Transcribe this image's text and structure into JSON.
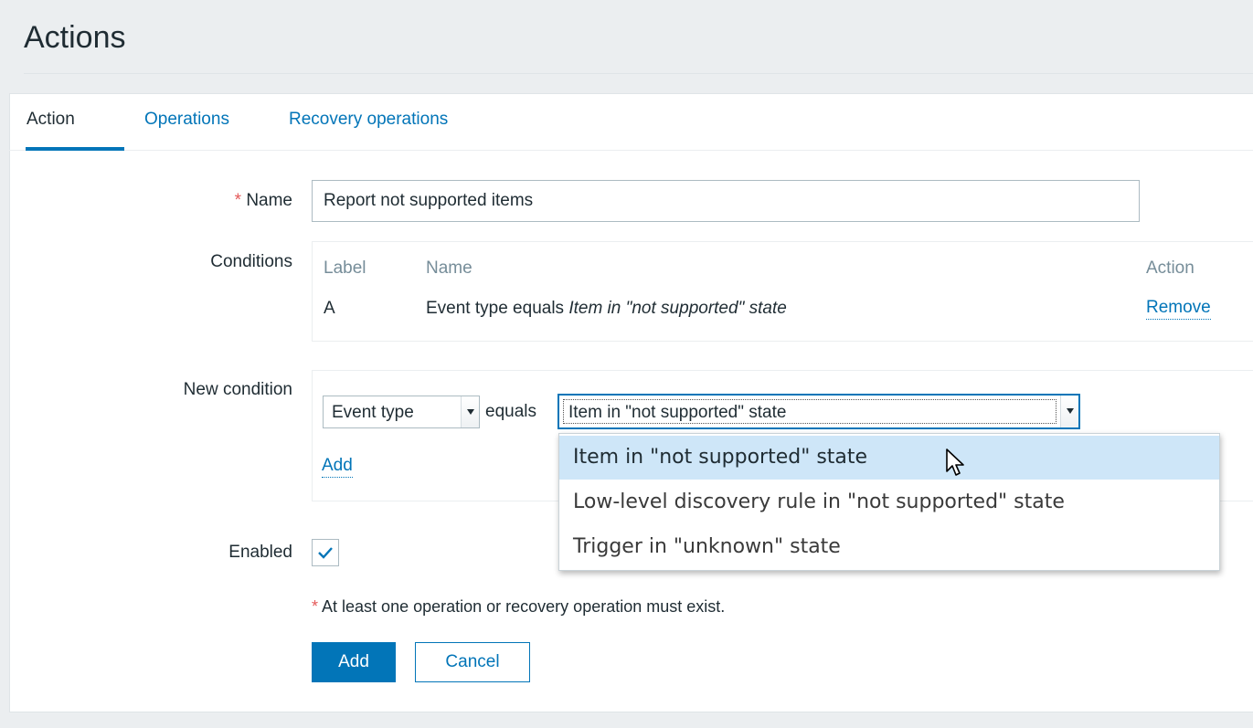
{
  "page": {
    "title": "Actions"
  },
  "tabs": [
    {
      "label": "Action",
      "active": true
    },
    {
      "label": "Operations",
      "active": false
    },
    {
      "label": "Recovery operations",
      "active": false
    }
  ],
  "form": {
    "name": {
      "label": "Name",
      "required_mark": "*",
      "value": "Report not supported items"
    },
    "conditions": {
      "label": "Conditions",
      "columns": {
        "label": "Label",
        "name": "Name",
        "action": "Action"
      },
      "rows": [
        {
          "label": "A",
          "name_prefix": "Event type equals",
          "name_value": "Item in \"not supported\" state",
          "action": "Remove"
        }
      ]
    },
    "new_condition": {
      "label": "New condition",
      "type_select": "Event type",
      "operator": "equals",
      "value_select": "Item in \"not supported\" state",
      "add_link": "Add",
      "dropdown_options": [
        "Item in \"not supported\" state",
        "Low-level discovery rule in \"not supported\" state",
        "Trigger in \"unknown\" state"
      ],
      "hovered_option": 0
    },
    "enabled": {
      "label": "Enabled",
      "checked": true
    },
    "note": {
      "mark": "*",
      "text": "At least one operation or recovery operation must exist."
    },
    "buttons": {
      "add": "Add",
      "cancel": "Cancel"
    }
  },
  "colors": {
    "accent": "#0275b8",
    "required": "#e45959",
    "background": "#ebeef0",
    "hover": "#cee6f8"
  }
}
